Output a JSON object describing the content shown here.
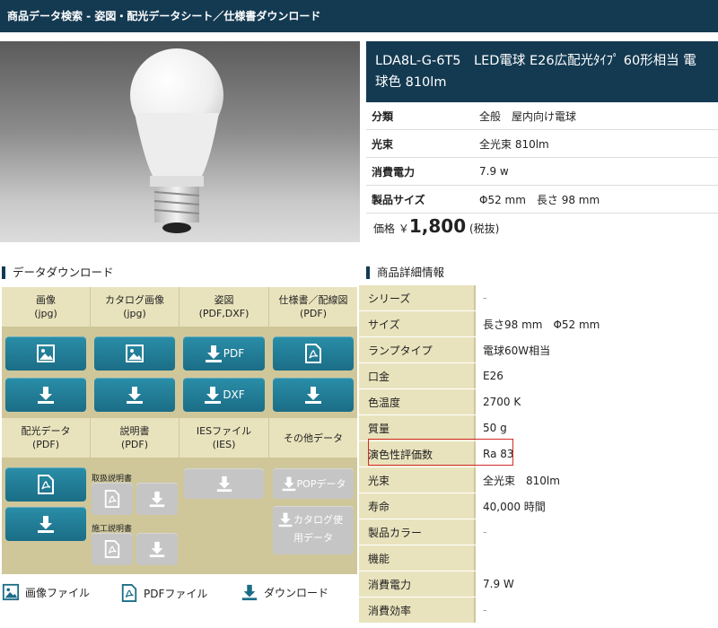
{
  "breadcrumb": "商品データ検索 - 姿図・配光データシート／仕様書ダウンロード",
  "product": {
    "title": "LDA8L-G-6T5　LED電球 E26広配光ﾀｲﾌﾟ 60形相当 電球色 810lm",
    "specs": [
      {
        "key": "分類",
        "value": "全般　屋内向け電球"
      },
      {
        "key": "光束",
        "value": "全光束 810lm"
      },
      {
        "key": "消費電力",
        "value": "7.9 w"
      },
      {
        "key": "製品サイズ",
        "value": "Φ52 mm　長さ 98 mm"
      }
    ],
    "price_label": "価格",
    "price_currency": "￥",
    "price_value": "1,800",
    "price_tax": "(税抜)"
  },
  "download": {
    "heading": "データダウンロード",
    "col_headers_top": [
      "画像\n(jpg)",
      "カタログ画像\n(jpg)",
      "姿図\n(PDF,DXF)",
      "仕様書／配線図\n(PDF)"
    ],
    "col_headers_bottom": [
      "配光データ\n(PDF)",
      "説明書\n(PDF)",
      "IESファイル\n(IES)",
      "その他データ"
    ],
    "pdf_label": "PDF",
    "dxf_label": "DXF",
    "manual1": "取扱説明書",
    "manual2": "施工説明書",
    "pop_label": "POPデータ",
    "catalog_label": "カタログ使用データ"
  },
  "legend": {
    "image": "画像ファイル",
    "pdf": "PDFファイル",
    "download": "ダウンロード"
  },
  "details": {
    "heading": "商品詳細情報",
    "rows": [
      {
        "key": "シリーズ",
        "value": "-"
      },
      {
        "key": "サイズ",
        "value": "長さ98 mm　Φ52 mm"
      },
      {
        "key": "ランプタイプ",
        "value": "電球60W相当"
      },
      {
        "key": "口金",
        "value": "E26"
      },
      {
        "key": "色温度",
        "value": "2700 K"
      },
      {
        "key": "質量",
        "value": "50 g"
      },
      {
        "key": "演色性評価数",
        "value": "Ra 83"
      },
      {
        "key": "光束",
        "value": "全光束　810lm"
      },
      {
        "key": "寿命",
        "value": "40,000 時間"
      },
      {
        "key": "製品カラー",
        "value": "-"
      },
      {
        "key": "機能",
        "value": ""
      },
      {
        "key": "消費電力",
        "value": "7.9 W"
      },
      {
        "key": "消費効率",
        "value": "-"
      }
    ]
  }
}
